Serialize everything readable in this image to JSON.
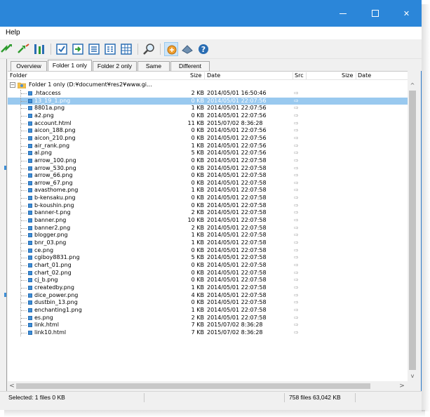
{
  "menu": {
    "help": "Help"
  },
  "window_controls": {
    "close": "✕"
  },
  "tabs": [
    {
      "label": "Overview",
      "active": false
    },
    {
      "label": "Folder 1 only",
      "active": true
    },
    {
      "label": "Folder 2 only",
      "active": false
    },
    {
      "label": "Same",
      "active": false
    },
    {
      "label": "Different",
      "active": false
    }
  ],
  "columns": {
    "folder": "Folder",
    "size": "Size",
    "date": "Date",
    "src": "Src",
    "size2": "Size",
    "date2": "Date"
  },
  "root": {
    "label": "Folder 1 only (D:¥document¥res2¥www.gi...",
    "icon": "folder-icon"
  },
  "files": [
    {
      "name": ".htaccess",
      "size": "2 KB",
      "date": "2014/05/01 16:50:46",
      "selected": false
    },
    {
      "name": "13_19_1.png",
      "size": "0 KB",
      "date": "2014/05/01 22:07:56",
      "selected": true
    },
    {
      "name": "8801a.png",
      "size": "1 KB",
      "date": "2014/05/01 22:07:56",
      "selected": false
    },
    {
      "name": "a2.png",
      "size": "0 KB",
      "date": "2014/05/01 22:07:56",
      "selected": false
    },
    {
      "name": "account.html",
      "size": "11 KB",
      "date": "2015/07/02 8:36:28",
      "selected": false
    },
    {
      "name": "aicon_188.png",
      "size": "0 KB",
      "date": "2014/05/01 22:07:56",
      "selected": false
    },
    {
      "name": "aicon_210.png",
      "size": "0 KB",
      "date": "2014/05/01 22:07:56",
      "selected": false
    },
    {
      "name": "air_rank.png",
      "size": "1 KB",
      "date": "2014/05/01 22:07:56",
      "selected": false
    },
    {
      "name": "al.png",
      "size": "5 KB",
      "date": "2014/05/01 22:07:56",
      "selected": false
    },
    {
      "name": "arrow_100.png",
      "size": "0 KB",
      "date": "2014/05/01 22:07:58",
      "selected": false
    },
    {
      "name": "arrow_530.png",
      "size": "0 KB",
      "date": "2014/05/01 22:07:58",
      "selected": false
    },
    {
      "name": "arrow_66.png",
      "size": "0 KB",
      "date": "2014/05/01 22:07:58",
      "selected": false
    },
    {
      "name": "arrow_67.png",
      "size": "0 KB",
      "date": "2014/05/01 22:07:58",
      "selected": false
    },
    {
      "name": "avasthome.png",
      "size": "1 KB",
      "date": "2014/05/01 22:07:58",
      "selected": false
    },
    {
      "name": "b-kensaku.png",
      "size": "0 KB",
      "date": "2014/05/01 22:07:58",
      "selected": false
    },
    {
      "name": "b-koushin.png",
      "size": "0 KB",
      "date": "2014/05/01 22:07:58",
      "selected": false
    },
    {
      "name": "banner-t.png",
      "size": "2 KB",
      "date": "2014/05/01 22:07:58",
      "selected": false
    },
    {
      "name": "banner.png",
      "size": "10 KB",
      "date": "2014/05/01 22:07:58",
      "selected": false
    },
    {
      "name": "banner2.png",
      "size": "2 KB",
      "date": "2014/05/01 22:07:58",
      "selected": false
    },
    {
      "name": "blogger.png",
      "size": "1 KB",
      "date": "2014/05/01 22:07:58",
      "selected": false
    },
    {
      "name": "bnr_03.png",
      "size": "1 KB",
      "date": "2014/05/01 22:07:58",
      "selected": false
    },
    {
      "name": "ce.png",
      "size": "0 KB",
      "date": "2014/05/01 22:07:58",
      "selected": false
    },
    {
      "name": "cgiboy8831.png",
      "size": "5 KB",
      "date": "2014/05/01 22:07:58",
      "selected": false
    },
    {
      "name": "chart_01.png",
      "size": "0 KB",
      "date": "2014/05/01 22:07:58",
      "selected": false
    },
    {
      "name": "chart_02.png",
      "size": "0 KB",
      "date": "2014/05/01 22:07:58",
      "selected": false
    },
    {
      "name": "cj_b.png",
      "size": "0 KB",
      "date": "2014/05/01 22:07:58",
      "selected": false
    },
    {
      "name": "createdby.png",
      "size": "1 KB",
      "date": "2014/05/01 22:07:58",
      "selected": false
    },
    {
      "name": "dice_power.png",
      "size": "4 KB",
      "date": "2014/05/01 22:07:58",
      "selected": false
    },
    {
      "name": "dustbin_13.png",
      "size": "0 KB",
      "date": "2014/05/01 22:07:58",
      "selected": false
    },
    {
      "name": "enchanting1.png",
      "size": "1 KB",
      "date": "2014/05/01 22:07:58",
      "selected": false
    },
    {
      "name": "es.png",
      "size": "2 KB",
      "date": "2014/05/01 22:07:58",
      "selected": false
    },
    {
      "name": "link.html",
      "size": "7 KB",
      "date": "2015/07/02 8:36:28",
      "selected": false
    },
    {
      "name": "link10.html",
      "size": "7 KB",
      "date": "2015/07/02 8:36:28",
      "selected": false
    }
  ],
  "src_arrow": "⇨",
  "scroll": {
    "up": "^",
    "down": "v",
    "left": "<",
    "right": ">"
  },
  "status": {
    "selected": "Selected: 1 files 0 KB",
    "totals": "758 files 63,042 KB"
  },
  "colors": {
    "titlebar": "#2b86d9",
    "selection": "#99c9ef",
    "file_icon": "#3c8ed6"
  }
}
